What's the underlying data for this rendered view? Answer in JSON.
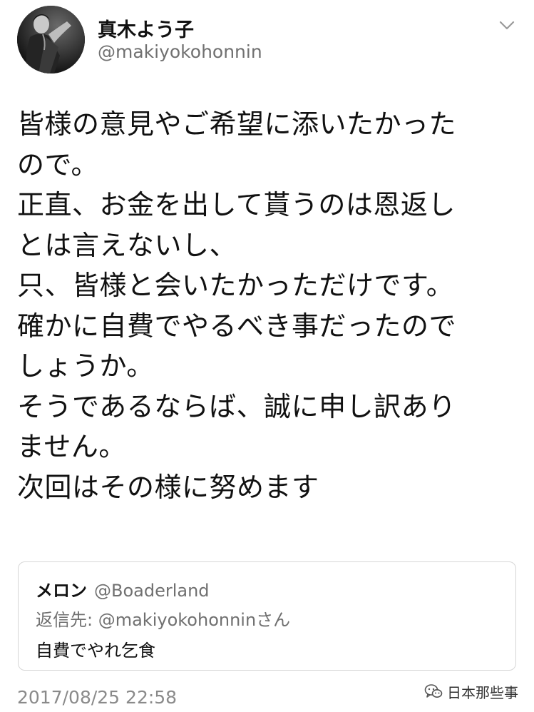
{
  "author": {
    "display_name": "真木よう子",
    "handle": "@makiyokohonnin"
  },
  "tweet": {
    "lines": [
      "皆様の意見やご希望に添いたかった",
      "ので。",
      "正直、お金を出して貰うのは恩返し",
      "とは言えないし、",
      "只、皆様と会いたかっただけです。",
      "確かに自費でやるべき事だったので",
      "しょうか。",
      "そうであるならば、誠に申し訳あり",
      "ません。",
      "次回はその様に努めます"
    ],
    "timestamp": "2017/08/25 22:58"
  },
  "quoted": {
    "name": "メロン",
    "handle": "@Boaderland",
    "reply_to": "返信先: @makiyokohonninさん",
    "text": "自費でやれ乞食"
  },
  "watermark": {
    "text": "日本那些事"
  },
  "icons": {
    "menu": "chevron-down-icon",
    "watermark": "wechat-icon"
  },
  "colors": {
    "text": "#111111",
    "secondary": "#707070",
    "border": "#d6d6d6",
    "background": "#ffffff"
  }
}
